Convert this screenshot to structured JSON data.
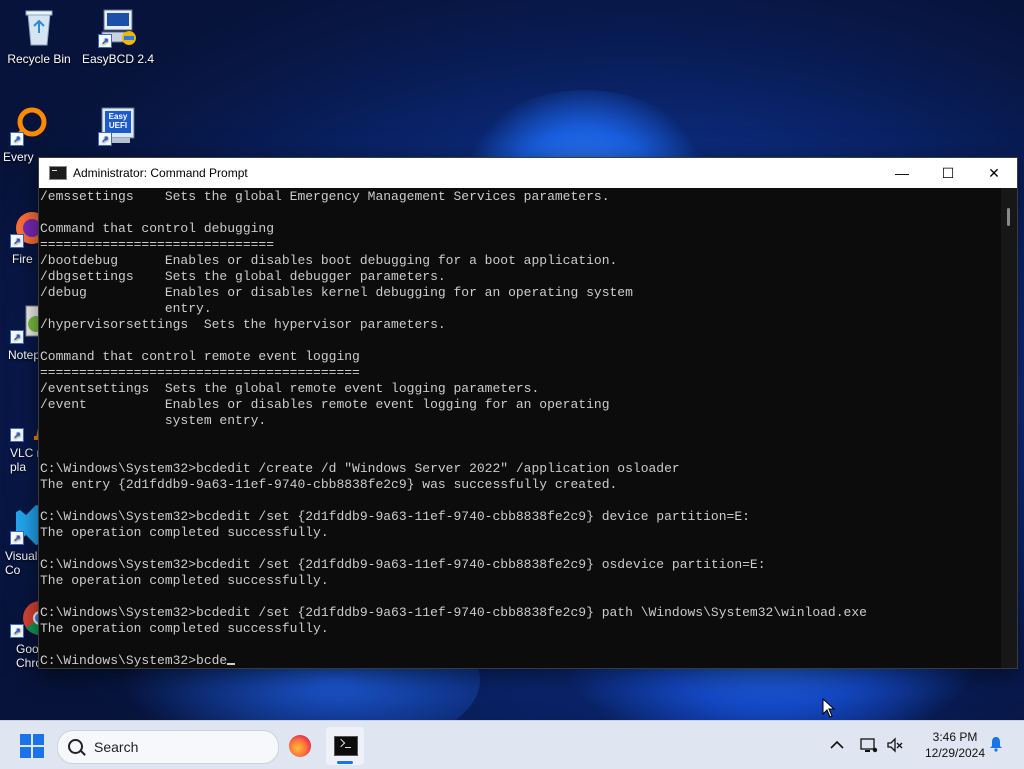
{
  "desktop": {
    "icons": [
      {
        "label": "Recycle Bin"
      },
      {
        "label": "EasyBCD 2.4"
      },
      {
        "label": "Every"
      },
      {
        "label": "Easy UEFI"
      },
      {
        "label": "Fire"
      },
      {
        "label": "Notep"
      },
      {
        "label": "VLC m pla"
      },
      {
        "label": "Visual Co"
      },
      {
        "label": "Goo Chrome"
      }
    ],
    "easyuefi_icon_text": "Easy UEFI"
  },
  "window": {
    "title": "Administrator: Command Prompt",
    "minimize_glyph": "—",
    "maximize_glyph": "☐",
    "close_glyph": "✕",
    "console_lines": [
      "/emssettings    Sets the global Emergency Management Services parameters.",
      "",
      "Command that control debugging",
      "==============================",
      "/bootdebug      Enables or disables boot debugging for a boot application.",
      "/dbgsettings    Sets the global debugger parameters.",
      "/debug          Enables or disables kernel debugging for an operating system",
      "                entry.",
      "/hypervisorsettings  Sets the hypervisor parameters.",
      "",
      "Command that control remote event logging",
      "=========================================",
      "/eventsettings  Sets the global remote event logging parameters.",
      "/event          Enables or disables remote event logging for an operating",
      "                system entry.",
      "",
      "",
      "C:\\Windows\\System32>bcdedit /create /d \"Windows Server 2022\" /application osloader",
      "The entry {2d1fddb9-9a63-11ef-9740-cbb8838fe2c9} was successfully created.",
      "",
      "C:\\Windows\\System32>bcdedit /set {2d1fddb9-9a63-11ef-9740-cbb8838fe2c9} device partition=E:",
      "The operation completed successfully.",
      "",
      "C:\\Windows\\System32>bcdedit /set {2d1fddb9-9a63-11ef-9740-cbb8838fe2c9} osdevice partition=E:",
      "The operation completed successfully.",
      "",
      "C:\\Windows\\System32>bcdedit /set {2d1fddb9-9a63-11ef-9740-cbb8838fe2c9} path \\Windows\\System32\\winload.exe",
      "The operation completed successfully.",
      ""
    ],
    "prompt_line": "C:\\Windows\\System32>bcde"
  },
  "taskbar": {
    "search_label": "Search",
    "time": "3:46 PM",
    "date": "12/29/2024"
  },
  "colors": {
    "accent": "#1a73e8",
    "console_bg": "#0c0c0c",
    "console_fg": "#cccccc"
  }
}
